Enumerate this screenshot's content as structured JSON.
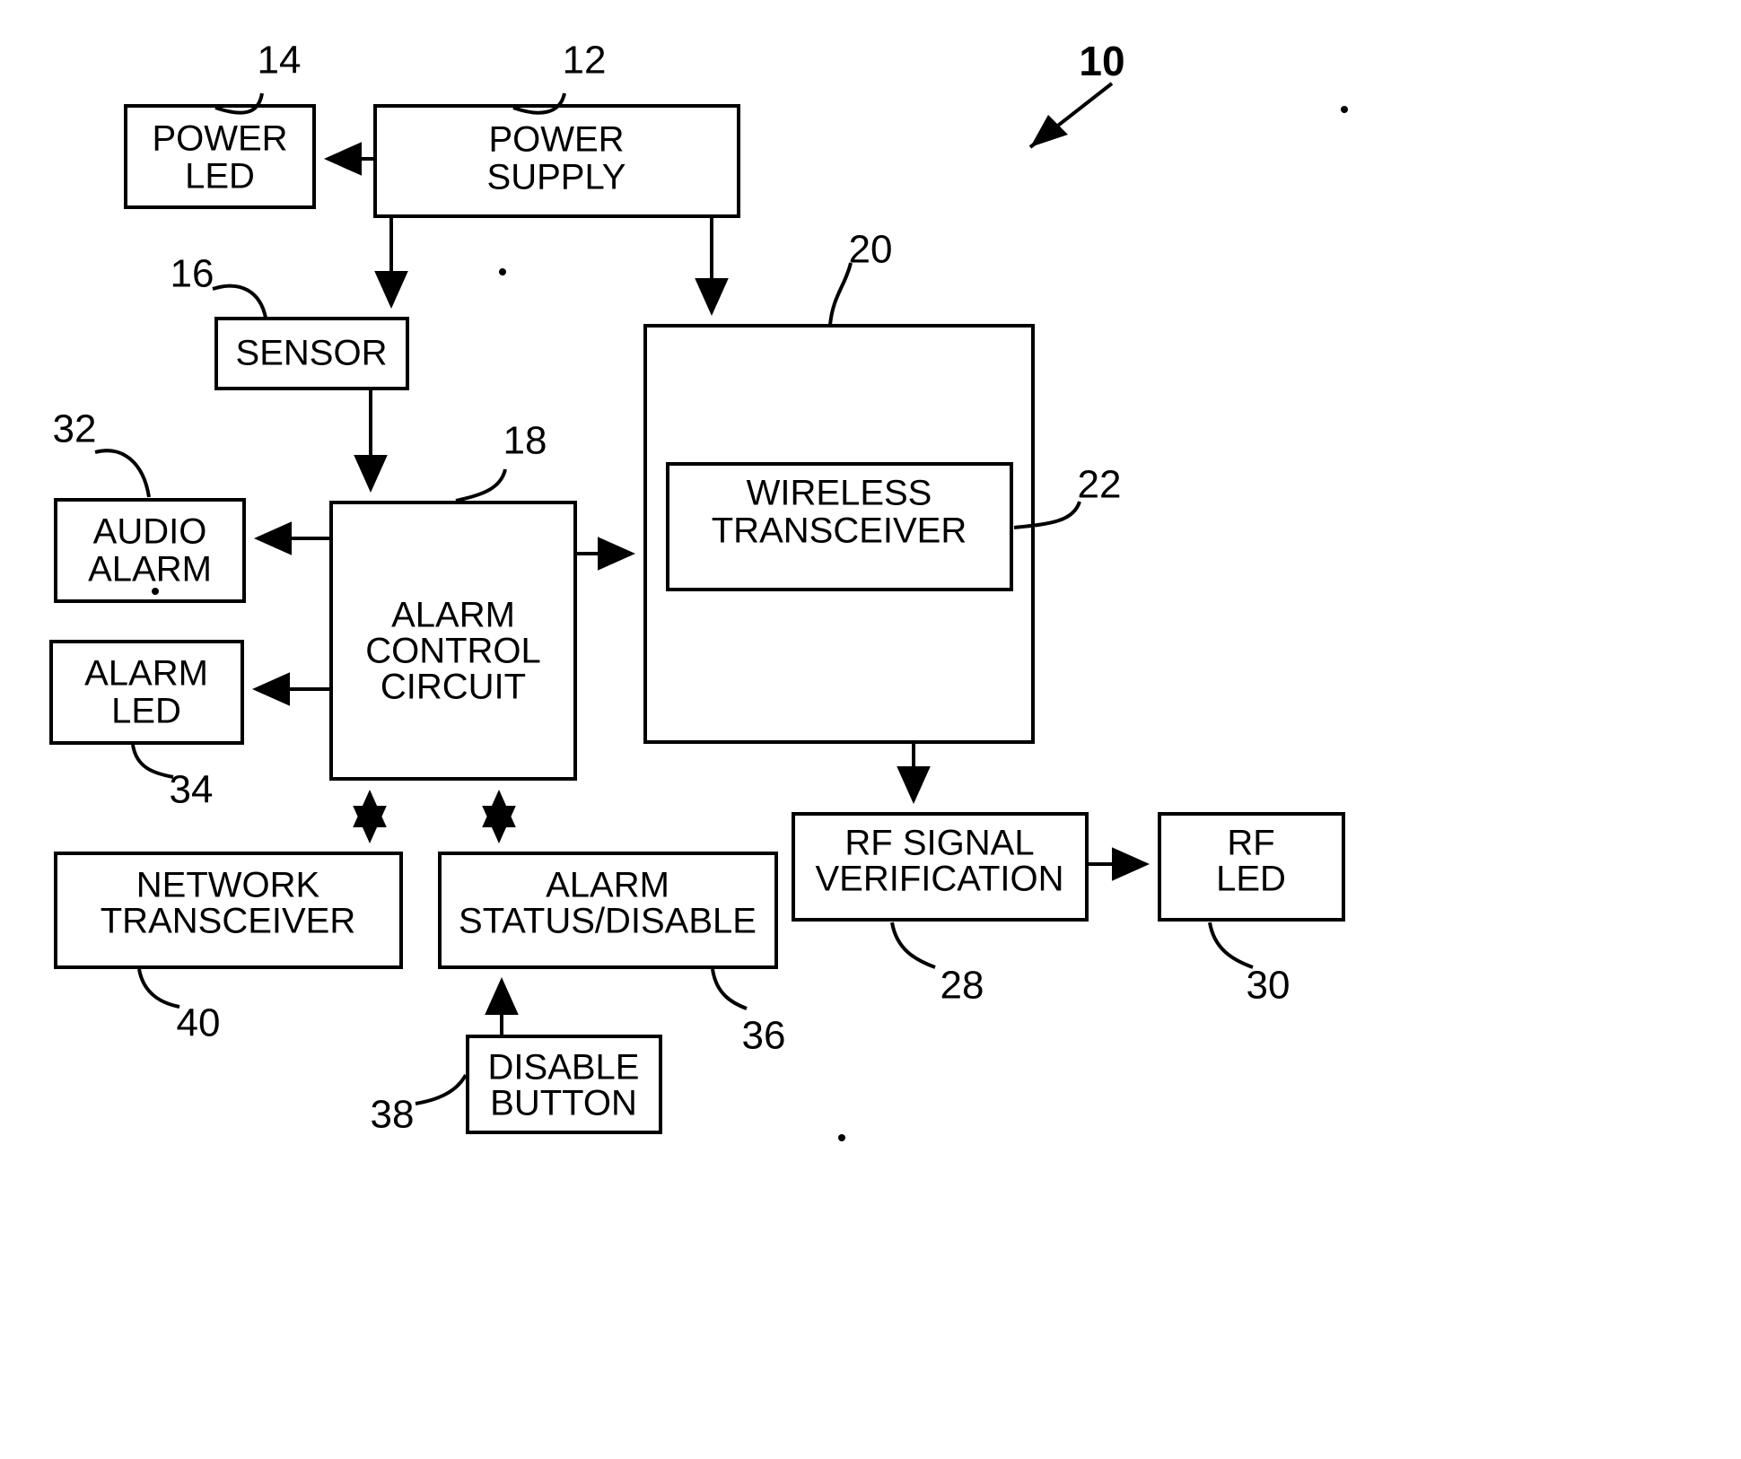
{
  "figure": {
    "number": "10",
    "background_color": "#ffffff",
    "line_color": "#000000"
  },
  "blocks": [
    {
      "id": "power_led",
      "label_line1": "POWER",
      "label_line2": "LED",
      "ref": "14"
    },
    {
      "id": "power_supply",
      "label_line1": "POWER",
      "label_line2": "SUPPLY",
      "ref": "12"
    },
    {
      "id": "sensor",
      "label_line1": "SENSOR",
      "label_line2": "",
      "ref": "16"
    },
    {
      "id": "alarm_control",
      "label_line1": "ALARM",
      "label_line2": "CONTROL",
      "label_line3": "CIRCUIT",
      "ref": "18"
    },
    {
      "id": "wireless_outer",
      "label_line1": "",
      "label_line2": "",
      "ref": "20"
    },
    {
      "id": "wireless_transceiver",
      "label_line1": "WIRELESS",
      "label_line2": "TRANSCEIVER",
      "ref": "22"
    },
    {
      "id": "audio_alarm",
      "label_line1": "AUDIO",
      "label_line2": "ALARM",
      "ref": "32"
    },
    {
      "id": "alarm_led",
      "label_line1": "ALARM",
      "label_line2": "LED",
      "ref": "34"
    },
    {
      "id": "network_transceiver",
      "label_line1": "NETWORK",
      "label_line2": "TRANSCEIVER",
      "ref": "40"
    },
    {
      "id": "alarm_status",
      "label_line1": "ALARM",
      "label_line2": "STATUS/DISABLE",
      "ref": "36"
    },
    {
      "id": "disable_button",
      "label_line1": "DISABLE",
      "label_line2": "BUTTON",
      "ref": "38"
    },
    {
      "id": "rf_signal_verification",
      "label_line1": "RF SIGNAL",
      "label_line2": "VERIFICATION",
      "ref": "28"
    },
    {
      "id": "rf_led",
      "label_line1": "RF",
      "label_line2": "LED",
      "ref": "30"
    }
  ],
  "connections": [
    {
      "from": "power_supply",
      "to": "power_led",
      "type": "arrow"
    },
    {
      "from": "power_supply",
      "to": "sensor",
      "type": "arrow"
    },
    {
      "from": "power_supply",
      "to": "wireless_outer",
      "type": "arrow"
    },
    {
      "from": "sensor",
      "to": "alarm_control",
      "type": "arrow"
    },
    {
      "from": "alarm_control",
      "to": "audio_alarm",
      "type": "arrow"
    },
    {
      "from": "alarm_control",
      "to": "alarm_led",
      "type": "arrow"
    },
    {
      "from": "alarm_control",
      "to": "wireless_outer",
      "type": "arrow"
    },
    {
      "from": "alarm_control",
      "to": "network_transceiver",
      "type": "double-arrow"
    },
    {
      "from": "alarm_control",
      "to": "alarm_status",
      "type": "double-arrow"
    },
    {
      "from": "disable_button",
      "to": "alarm_status",
      "type": "arrow"
    },
    {
      "from": "wireless_outer",
      "to": "rf_signal_verification",
      "type": "arrow"
    },
    {
      "from": "rf_signal_verification",
      "to": "rf_led",
      "type": "arrow"
    }
  ]
}
